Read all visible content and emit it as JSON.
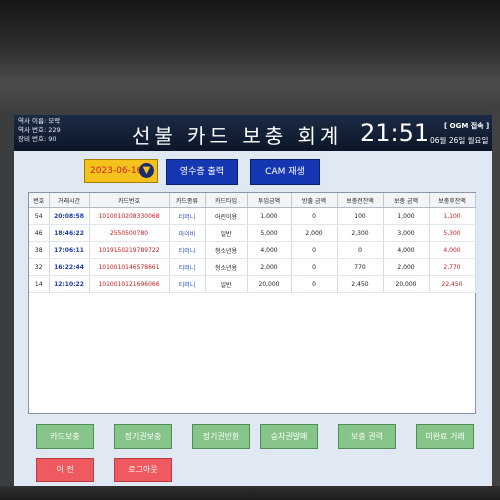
{
  "header": {
    "station_name": "역사 이름: 모락",
    "station_no": "역사 번호: 229",
    "device_no": "장비 번호: 90",
    "title": "선불 카드 보충 회계",
    "time": "21:51",
    "ogm_status": "[ OGM 접속 ]",
    "date": "06월 26일 월요일"
  },
  "toolbar": {
    "date_value": "2023-06-16",
    "receipt_button": "영수증 출력",
    "cam_button": "CAM 재생"
  },
  "table": {
    "columns": [
      "번호",
      "거래시간",
      "카드번호",
      "카드종류",
      "카드타입",
      "투입금액",
      "방출 금액",
      "보충전잔액",
      "보충 금액",
      "보충후잔액"
    ],
    "rows": [
      [
        "54",
        "20:08:58",
        "1010010208330068",
        "티머니",
        "어린이용",
        "1,000",
        "0",
        "100",
        "1,000",
        "1,100"
      ],
      [
        "46",
        "18:46:22",
        "2550500780",
        "마이비",
        "일반",
        "5,000",
        "2,000",
        "2,300",
        "3,000",
        "5,300"
      ],
      [
        "38",
        "17:06:11",
        "1019150219789722",
        "티머니",
        "청소년용",
        "4,000",
        "0",
        "0",
        "4,000",
        "4,000"
      ],
      [
        "32",
        "16:22:44",
        "1010010146578661",
        "티머니",
        "청소년용",
        "2,000",
        "0",
        "770",
        "2,000",
        "2,770"
      ],
      [
        "14",
        "12:10:22",
        "1010010121696066",
        "티머니",
        "일반",
        "20,000",
        "0",
        "2,450",
        "20,000",
        "22,450"
      ]
    ]
  },
  "buttons": {
    "card_recharge": "카드보충",
    "commuter_recharge": "정기권보충",
    "commuter_refund": "정기권반환",
    "ticket_sale": "승차권발매",
    "recharge_history": "보충 권력",
    "unfinished_tx": "미완료 거래",
    "prev": "이 전",
    "logout": "로그아웃"
  },
  "colors": {
    "header_bg": "#0c1628",
    "accent_blue": "#1637b2",
    "date_yellow": "#f3c21c",
    "green_button": "#86c48a",
    "red_button": "#ee5a5f"
  }
}
